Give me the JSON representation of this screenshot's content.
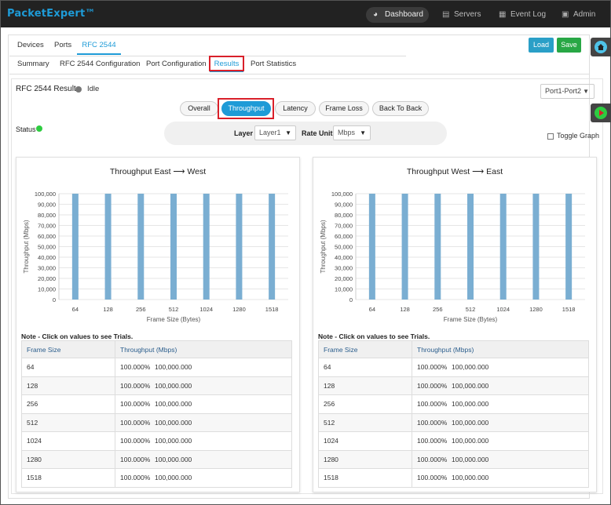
{
  "navbar": {
    "brand": "PacketExpert™",
    "items": [
      {
        "label": "Dashboard",
        "icon": "dashboard-icon",
        "active": true
      },
      {
        "label": "Servers",
        "icon": "servers-icon"
      },
      {
        "label": "Event Log",
        "icon": "calendar-icon"
      },
      {
        "label": "Admin",
        "icon": "admin-icon"
      }
    ]
  },
  "top_tabs": [
    "Devices",
    "Ports",
    "RFC 2544"
  ],
  "actions": {
    "load": "Load",
    "save": "Save"
  },
  "sub_tabs": [
    "Summary",
    "RFC 2544 Configuration",
    "Port Configuration",
    "Results",
    "Port Statistics"
  ],
  "results": {
    "title": "RFC 2544 Results",
    "state": "Idle",
    "port_pair": "Port1-Port2",
    "test_tabs": [
      "Overall",
      "Throughput",
      "Latency",
      "Frame Loss",
      "Back To Back"
    ],
    "status_label": "Status",
    "layer_label": "Layer",
    "layer_value": "Layer1",
    "rate_unit_label": "Rate Unit",
    "rate_unit_value": "Mbps",
    "toggle_graph": "Toggle Graph"
  },
  "colors": {
    "accent": "#1e9bd7",
    "bar": "#7aaed2",
    "status_ok": "#2ecc40",
    "highlight": "#d9202a"
  },
  "chart_data": [
    {
      "type": "bar",
      "title": "Throughput East ⟶ West",
      "xlabel": "Frame Size (Bytes)",
      "ylabel": "Throughput (Mbps)",
      "categories": [
        "64",
        "128",
        "256",
        "512",
        "1024",
        "1280",
        "1518"
      ],
      "values": [
        100000,
        100000,
        100000,
        100000,
        100000,
        100000,
        100000
      ],
      "ylim": [
        0,
        100000
      ],
      "yticks": [
        "0",
        "10,000",
        "20,000",
        "30,000",
        "40,000",
        "50,000",
        "60,000",
        "70,000",
        "80,000",
        "90,000",
        "100,000"
      ],
      "grid": true
    },
    {
      "type": "bar",
      "title": "Throughput West ⟶ East",
      "xlabel": "Frame Size (Bytes)",
      "ylabel": "Throughput (Mbps)",
      "categories": [
        "64",
        "128",
        "256",
        "512",
        "1024",
        "1280",
        "1518"
      ],
      "values": [
        100000,
        100000,
        100000,
        100000,
        100000,
        100000,
        100000
      ],
      "ylim": [
        0,
        100000
      ],
      "yticks": [
        "0",
        "10,000",
        "20,000",
        "30,000",
        "40,000",
        "50,000",
        "60,000",
        "70,000",
        "80,000",
        "90,000",
        "100,000"
      ],
      "grid": true
    }
  ],
  "tables": {
    "note": "Note - Click on values to see Trials.",
    "headers": [
      "Frame Size",
      "Throughput (Mbps)"
    ],
    "east_west": [
      {
        "size": "64",
        "pct": "100.000%",
        "value": "100,000.000"
      },
      {
        "size": "128",
        "pct": "100.000%",
        "value": "100,000.000"
      },
      {
        "size": "256",
        "pct": "100.000%",
        "value": "100,000.000"
      },
      {
        "size": "512",
        "pct": "100.000%",
        "value": "100,000.000"
      },
      {
        "size": "1024",
        "pct": "100.000%",
        "value": "100,000.000"
      },
      {
        "size": "1280",
        "pct": "100.000%",
        "value": "100,000.000"
      },
      {
        "size": "1518",
        "pct": "100.000%",
        "value": "100,000.000"
      }
    ],
    "west_east": [
      {
        "size": "64",
        "pct": "100.000%",
        "value": "100,000.000"
      },
      {
        "size": "128",
        "pct": "100.000%",
        "value": "100,000.000"
      },
      {
        "size": "256",
        "pct": "100.000%",
        "value": "100,000.000"
      },
      {
        "size": "512",
        "pct": "100.000%",
        "value": "100,000.000"
      },
      {
        "size": "1024",
        "pct": "100.000%",
        "value": "100,000.000"
      },
      {
        "size": "1280",
        "pct": "100.000%",
        "value": "100,000.000"
      },
      {
        "size": "1518",
        "pct": "100.000%",
        "value": "100,000.000"
      }
    ]
  }
}
